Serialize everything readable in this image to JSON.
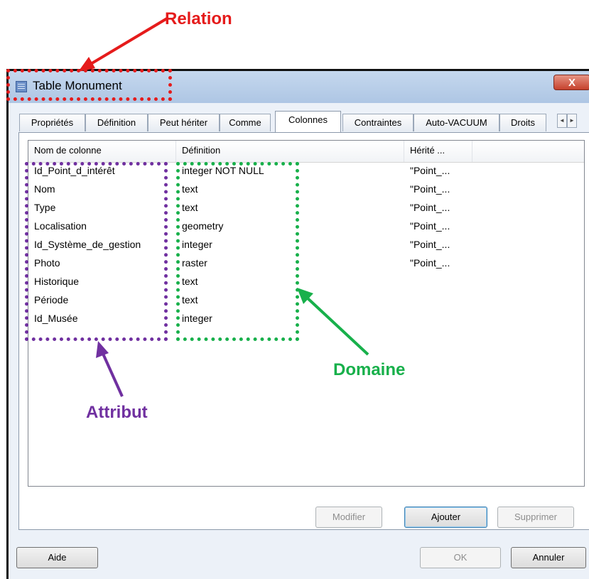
{
  "annotations": {
    "relation": "Relation",
    "domaine": "Domaine",
    "attribut": "Attribut",
    "colors": {
      "relation": "#e51b1b",
      "domaine": "#18b04b",
      "attribut": "#7030a0"
    }
  },
  "window": {
    "title": "Table Monument",
    "close_glyph": "X"
  },
  "tabs": [
    {
      "label": "Propriétés"
    },
    {
      "label": "Définition"
    },
    {
      "label": "Peut hériter"
    },
    {
      "label": "Comme"
    },
    {
      "label": "Colonnes",
      "active": true
    },
    {
      "label": "Contraintes"
    },
    {
      "label": "Auto-VACUUM"
    },
    {
      "label": "Droits"
    }
  ],
  "tab_scroll": {
    "left": "◄",
    "right": "►"
  },
  "columns_table": {
    "headers": [
      "Nom de colonne",
      "Définition",
      "Hérité ..."
    ],
    "rows": [
      {
        "name": "Id_Point_d_intérêt",
        "definition": "integer NOT NULL",
        "inherited": "\"Point_..."
      },
      {
        "name": "Nom",
        "definition": "text",
        "inherited": "\"Point_..."
      },
      {
        "name": "Type",
        "definition": "text",
        "inherited": "\"Point_..."
      },
      {
        "name": "Localisation",
        "definition": "geometry",
        "inherited": "\"Point_..."
      },
      {
        "name": "Id_Système_de_gestion",
        "definition": "integer",
        "inherited": "\"Point_..."
      },
      {
        "name": "Photo",
        "definition": "raster",
        "inherited": "\"Point_..."
      },
      {
        "name": "Historique",
        "definition": "text",
        "inherited": ""
      },
      {
        "name": "Période",
        "definition": "text",
        "inherited": ""
      },
      {
        "name": "Id_Musée",
        "definition": "integer",
        "inherited": ""
      }
    ]
  },
  "panel_buttons": {
    "modify": "Modifier",
    "add": "Ajouter",
    "delete": "Supprimer"
  },
  "dialog_buttons": {
    "help": "Aide",
    "ok": "OK",
    "cancel": "Annuler"
  }
}
